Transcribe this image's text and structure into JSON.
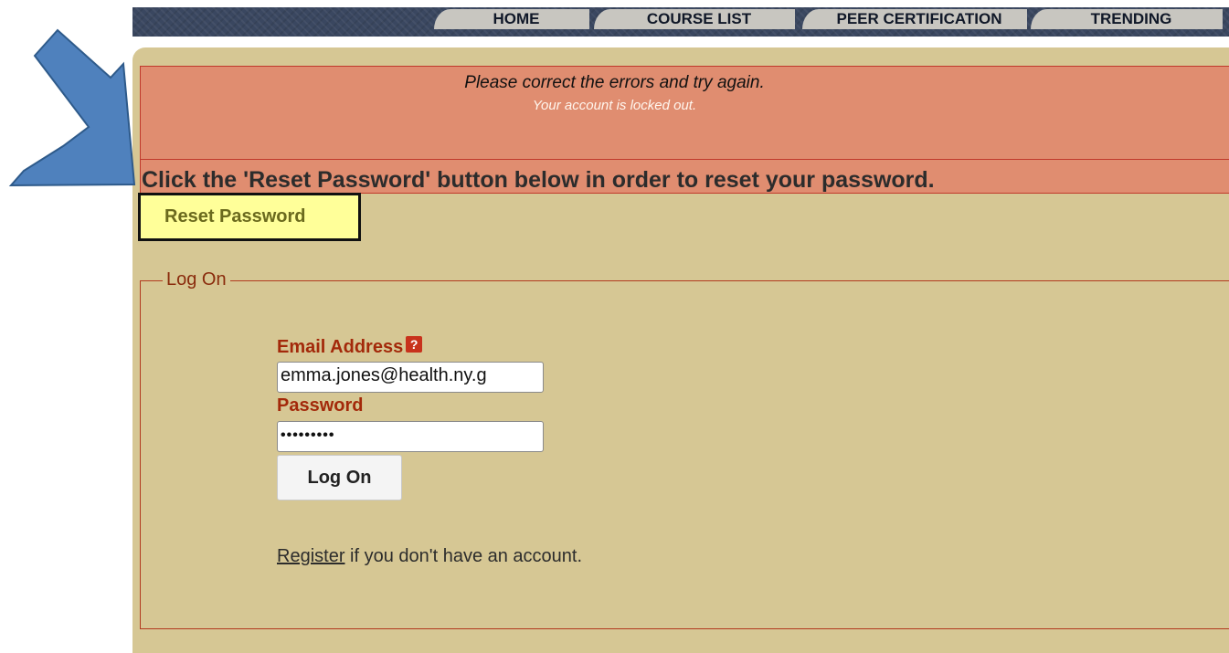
{
  "nav": {
    "tabs": [
      {
        "label": "HOME"
      },
      {
        "label": "COURSE LIST"
      },
      {
        "label": "PEER CERTIFICATION"
      },
      {
        "label": "TRENDING"
      }
    ]
  },
  "errors": {
    "title": "Please correct the errors and try again.",
    "message": "Your account is locked out."
  },
  "instruction": "Click the 'Reset Password' button below in order to reset your password.",
  "reset_button": "Reset Password",
  "logon": {
    "legend": "Log On",
    "email_label": "Email Address",
    "help_icon": "?",
    "email_value": "emma.jones@health.ny.g",
    "password_label": "Password",
    "password_value": "•••••••••",
    "submit_label": "Log On",
    "register_link": "Register",
    "register_text": " if you don't have an account."
  },
  "colors": {
    "nav": "#3a4760",
    "panel": "#d6c794",
    "error_bg": "#e08d70",
    "highlight": "#ffff99",
    "arrow": "#4f81bd"
  }
}
